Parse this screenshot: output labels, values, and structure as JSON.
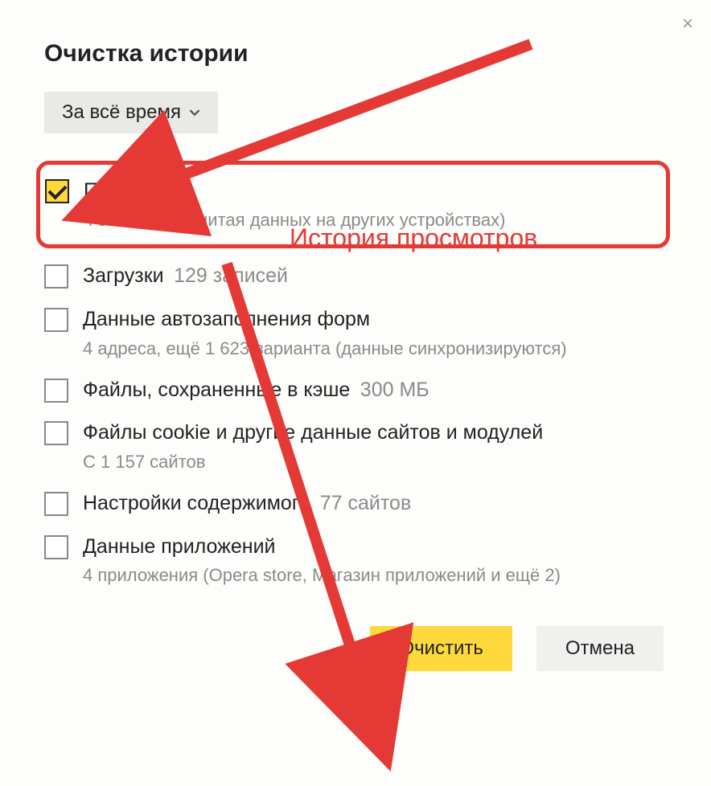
{
  "dialog": {
    "title": "Очистка истории",
    "close_glyph": "×",
    "time_range": "За всё время"
  },
  "options": {
    "views": {
      "label": "Просмотры",
      "detail": "4 записи (не считая данных на других устройствах)"
    },
    "downloads": {
      "label": "Загрузки",
      "inline": "129 записей"
    },
    "autofill": {
      "label": "Данные автозаполнения форм",
      "detail": "4 адреса, ещё 1 623 варианта (данные синхронизируются)"
    },
    "cache": {
      "label": "Файлы, сохраненные в кэше",
      "inline": "300 МБ"
    },
    "cookies": {
      "label": "Файлы cookie и другие данные сайтов и модулей",
      "detail": "С 1 157 сайтов"
    },
    "content": {
      "label": "Настройки содержимого",
      "inline": "77 сайтов"
    },
    "apps": {
      "label": "Данные приложений",
      "detail": "4 приложения (Opera store, Магазин приложений и ещё 2)"
    }
  },
  "buttons": {
    "clear": "Очистить",
    "cancel": "Отмена"
  },
  "annotation": {
    "label": "История просмотров"
  }
}
